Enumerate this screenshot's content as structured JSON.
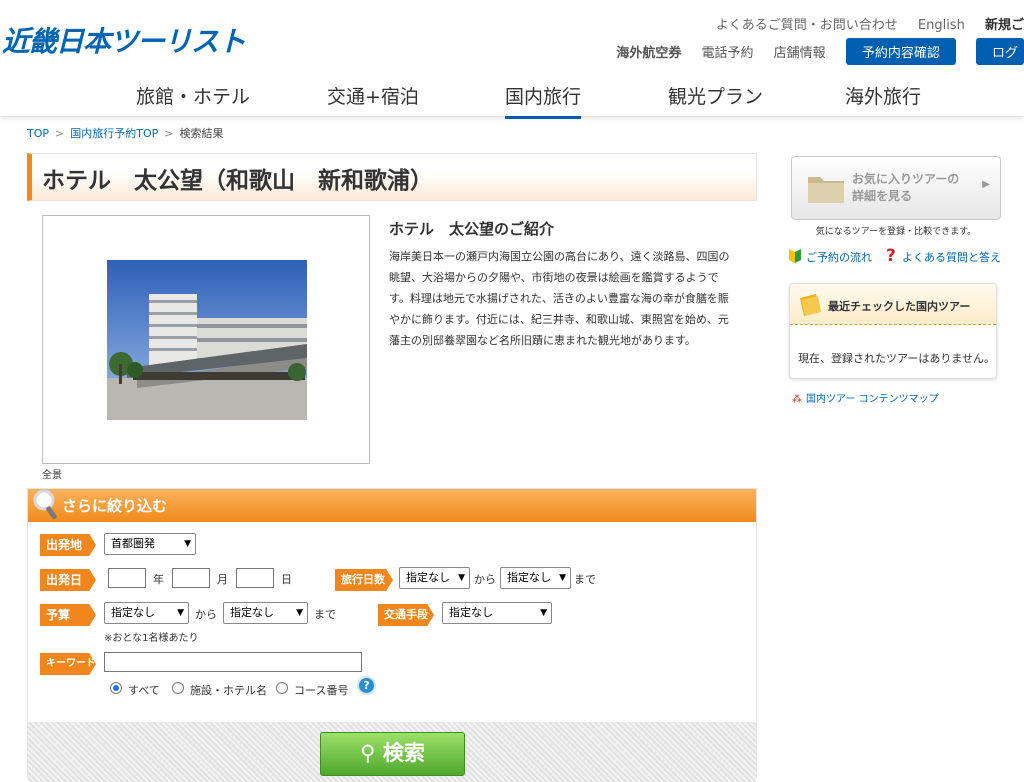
{
  "header": {
    "logo": "近畿日本ツーリスト",
    "util_links": [
      "よくあるご質問・お問い合わせ",
      "English",
      "新規ご"
    ],
    "sub_links": [
      "海外航空券",
      "電話予約",
      "店舗情報"
    ],
    "confirm_button": "予約内容確認",
    "login_button": "ログ"
  },
  "nav": {
    "items": [
      "旅館・ホテル",
      "交通+宿泊",
      "国内旅行",
      "観光プラン",
      "海外旅行"
    ],
    "active": "国内旅行"
  },
  "breadcrumb": {
    "items": [
      "TOP",
      "国内旅行予約TOP",
      "検索結果"
    ],
    "separator": ">"
  },
  "hotel": {
    "title": "ホテル　太公望（和歌山　新和歌浦）",
    "photo_caption": "全景",
    "intro_title": "ホテル　太公望のご紹介",
    "intro_text": "海岸美日本一の瀬戸内海国立公園の高台にあり、遠く淡路島、四国の眺望、大浴場からの夕陽や、市街地の夜景は絵画を鑑賞するようです。料理は地元で水揚げされた、活きのよい豊富な海の幸が食膳を賑やかに飾ります。付近には、紀三井寺、和歌山城、東照宮を始め、元藩主の別邸養翠園など名所旧蹟に恵まれた観光地があります。"
  },
  "filter": {
    "title": "さらに絞り込む",
    "departure_label": "出発地",
    "departure_value": "首都圏発",
    "date_label": "出発日",
    "year_unit": "年",
    "month_unit": "月",
    "day_unit": "日",
    "days_label": "旅行日数",
    "days_from": "指定なし",
    "days_to": "指定なし",
    "from_text": "から",
    "to_text": "まで",
    "budget_label": "予算",
    "budget_from": "指定なし",
    "budget_to": "指定なし",
    "budget_note": "※おとな1名様あたり",
    "transport_label": "交通手段",
    "transport_value": "指定なし",
    "keyword_label": "キーワード",
    "radio_options": [
      "すべて",
      "施設・ホテル名",
      "コース番号"
    ],
    "radio_selected": "すべて",
    "help_icon": "?",
    "search_button": "検索"
  },
  "sidebar": {
    "favorite_button": "お気に入りツアーの\n詳細を見る",
    "favorite_note": "気になるツアーを登録・比較できます。",
    "flow_link": "ご予約の流れ",
    "faq_link": "よくある質問と答え",
    "recent_title": "最近チェックした国内ツアー",
    "recent_empty": "現在、登録されたツアーはありません。",
    "content_map": "国内ツアー コンテンツマップ"
  },
  "colors": {
    "brand_blue": "#0066b3",
    "accent_orange": "#f08a1c",
    "link_blue": "#0068b7",
    "search_green": "#5cb234"
  }
}
